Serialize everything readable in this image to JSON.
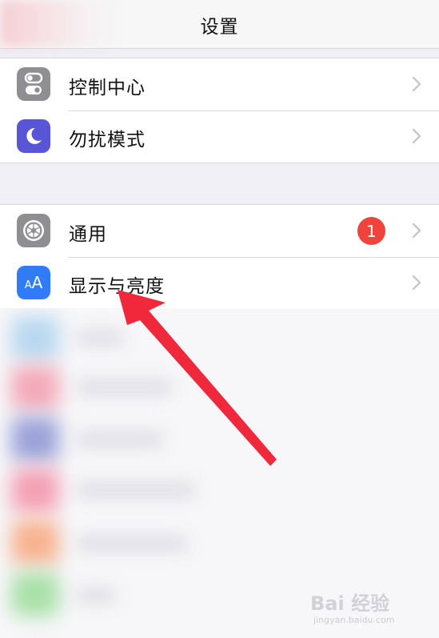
{
  "nav": {
    "title": "设置"
  },
  "group1": {
    "items": [
      {
        "label": "控制中心",
        "icon": "control-center-icon",
        "icon_color": "#8e8e93"
      },
      {
        "label": "勿扰模式",
        "icon": "moon-icon",
        "icon_color": "#5856d6"
      }
    ]
  },
  "group2": {
    "items": [
      {
        "label": "通用",
        "icon": "gear-icon",
        "icon_color": "#8e8e93",
        "badge": "1"
      },
      {
        "label": "显示与亮度",
        "icon": "text-size-icon",
        "icon_color": "#2f7cf6",
        "icon_text": "AA"
      }
    ]
  },
  "colors": {
    "badge": "#f0433c",
    "arrow": "#f0283c",
    "chevron": "#c7c7cc"
  },
  "watermark": {
    "main": "Bai 经验",
    "url": "jingyan.baidu.com"
  }
}
